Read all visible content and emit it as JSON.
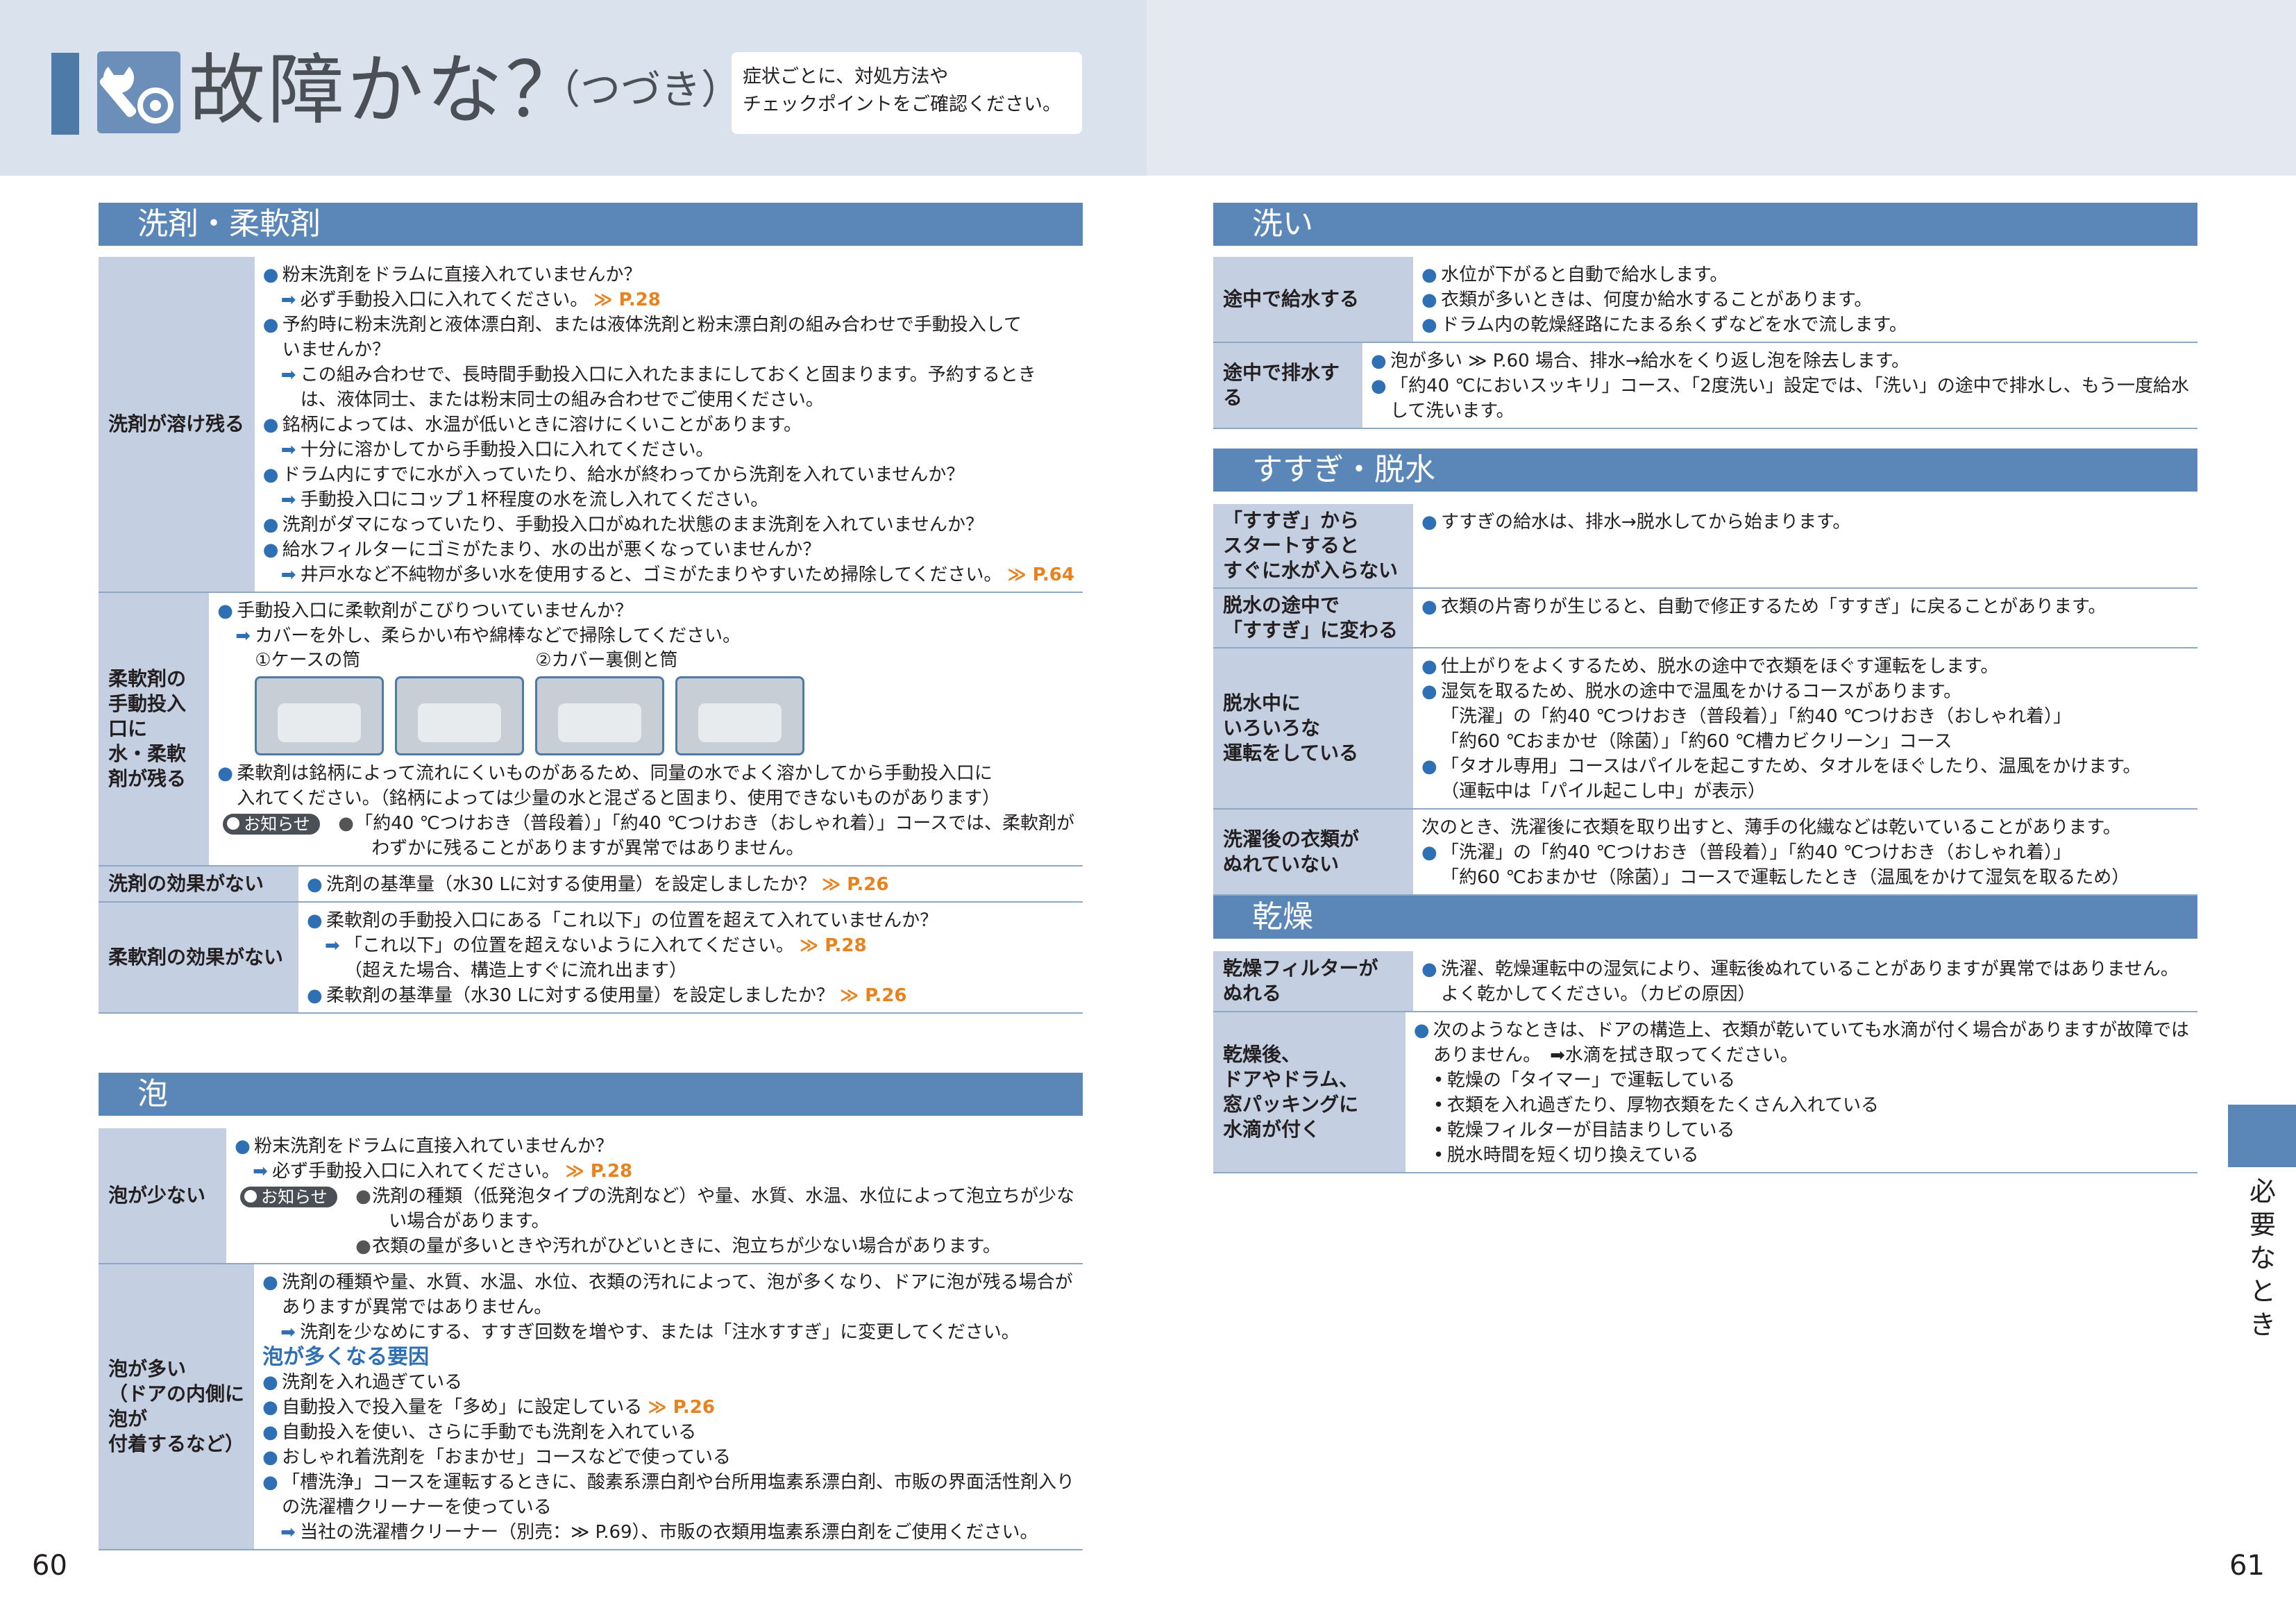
{
  "header": {
    "title": "故障かな？",
    "title_sub": "（つづき）",
    "note_lines": [
      "症状ごとに、対処方法や",
      "チェックポイントをご確認ください。"
    ]
  },
  "left": {
    "detergent": {
      "heading": "洗剤・柔軟剤",
      "rows": [
        {
          "label": [
            "洗剤が溶け残る"
          ],
          "lines": [
            {
              "t": "b",
              "s": "粉末洗剤をドラムに直接入れていませんか？"
            },
            {
              "t": "ar",
              "s": "必ず手動投入口に入れてください。",
              "ref": "≫ P.28"
            },
            {
              "t": "b",
              "s": "予約時に粉末洗剤と液体漂白剤、または液体洗剤と粉末漂白剤の組み合わせで手動投入して"
            },
            {
              "t": "in2",
              "s": "いませんか？"
            },
            {
              "t": "ar",
              "s": "この組み合わせで、長時間手動投入口に入れたままにしておくと固まります。予約するとき"
            },
            {
              "t": "in",
              "s": "は、液体同士、または粉末同士の組み合わせでご使用ください。"
            },
            {
              "t": "b",
              "s": "銘柄によっては、水温が低いときに溶けにくいことがあります。"
            },
            {
              "t": "ar",
              "s": "十分に溶かしてから手動投入口に入れてください。"
            },
            {
              "t": "b",
              "s": "ドラム内にすでに水が入っていたり、給水が終わってから洗剤を入れていませんか？"
            },
            {
              "t": "ar",
              "s": "手動投入口にコップ１杯程度の水を流し入れてください。"
            },
            {
              "t": "b",
              "s": "洗剤がダマになっていたり、手動投入口がぬれた状態のまま洗剤を入れていませんか？"
            },
            {
              "t": "b",
              "s": "給水フィルターにゴミがたまり、水の出が悪くなっていませんか？"
            },
            {
              "t": "ar",
              "s": "井戸水など不純物が多い水を使用すると、ゴミがたまりやすいため掃除してください。",
              "ref": "≫ P.64"
            }
          ]
        },
        {
          "label": [
            "柔軟剤の",
            "手動投入口に",
            "水・柔軟剤が残る"
          ],
          "photos": true,
          "lines": [
            {
              "t": "b",
              "s": "手動投入口に柔軟剤がこびりついていませんか？"
            },
            {
              "t": "ar",
              "s": "カバーを外し、柔らかい布や綿棒などで掃除してください。"
            }
          ],
          "photo_caps": [
            "①ケースの筒",
            "②カバー裏側と筒"
          ],
          "lines2": [
            {
              "t": "b",
              "s": "柔軟剤は銘柄によって流れにくいものがあるため、同量の水でよく溶かしてから手動投入口に"
            },
            {
              "t": "in2",
              "s": "入れてください。（銘柄によっては少量の水と混ざると固まり、使用できないものがあります）"
            },
            {
              "t": "sb",
              "s": "「約40 ℃つけおき（普段着）」「約40 ℃つけおき（おしゃれ着）」コースでは、柔軟剤が",
              "badge": "お知らせ"
            },
            {
              "t": "sbi",
              "s": "わずかに残ることがありますが異常ではありません。"
            }
          ]
        },
        {
          "label": [
            "洗剤の効果がない"
          ],
          "lines": [
            {
              "t": "b",
              "s": "洗剤の基準量（水30 Lに対する使用量）を設定しましたか？",
              "ref": "≫ P.26"
            }
          ]
        },
        {
          "label": [
            "柔軟剤の効果がない"
          ],
          "lines": [
            {
              "t": "b",
              "s": "柔軟剤の手動投入口にある「これ以下」の位置を超えて入れていませんか？"
            },
            {
              "t": "ar",
              "s": "「これ以下」の位置を超えないように入れてください。",
              "ref": "≫ P.28"
            },
            {
              "t": "in",
              "s": "（超えた場合、構造上すぐに流れ出ます）"
            },
            {
              "t": "b",
              "s": "柔軟剤の基準量（水30 Lに対する使用量）を設定しましたか？",
              "ref": "≫ P.26"
            }
          ]
        }
      ]
    },
    "foam": {
      "heading": "泡",
      "rows": [
        {
          "label": [
            "泡が少ない"
          ],
          "lines": [
            {
              "t": "b",
              "s": "粉末洗剤をドラムに直接入れていませんか？"
            },
            {
              "t": "ar",
              "s": "必ず手動投入口に入れてください。",
              "ref": "≫ P.28"
            },
            {
              "t": "sb",
              "s": "洗剤の種類（低発泡タイプの洗剤など）や量、水質、水温、水位によって泡立ちが少な",
              "badge": "お知らせ"
            },
            {
              "t": "sbi",
              "s": "い場合があります。"
            },
            {
              "t": "sb",
              "s": "衣類の量が多いときや汚れがひどいときに、泡立ちが少ない場合があります。"
            }
          ]
        },
        {
          "label": [
            "泡が多い",
            "（ドアの内側に泡が",
            "付着するなど）"
          ],
          "lines": [
            {
              "t": "b",
              "s": "洗剤の種類や量、水質、水温、水位、衣類の汚れによって、泡が多くなり、ドアに泡が残る場合が"
            },
            {
              "t": "in2",
              "s": "ありますが異常ではありません。"
            },
            {
              "t": "ar",
              "s": "洗剤を少なめにする、すすぎ回数を増やす、または「注水すすぎ」に変更してください。"
            },
            {
              "t": "hd",
              "s": "泡が多くなる要因"
            },
            {
              "t": "b",
              "s": "洗剤を入れ過ぎている"
            },
            {
              "t": "b",
              "s": "自動投入で投入量を「多め」に設定している",
              "ref": "≫ P.26"
            },
            {
              "t": "b",
              "s": "自動投入を使い、さらに手動でも洗剤を入れている"
            },
            {
              "t": "b",
              "s": "おしゃれ着洗剤を「おまかせ」コースなどで使っている"
            },
            {
              "t": "b",
              "s": "「槽洗浄」コースを運転するときに、酸素系漂白剤や台所用塩素系漂白剤、市販の界面活性剤入り"
            },
            {
              "t": "in2",
              "s": "の洗濯槽クリーナーを使っている"
            },
            {
              "t": "ar",
              "s": "当社の洗濯槽クリーナー（別売：≫ P.69）、市販の衣類用塩素系漂白剤をご使用ください。"
            }
          ]
        }
      ]
    }
  },
  "right": {
    "wash": {
      "heading": "洗い",
      "rows": [
        {
          "label": [
            "途中で給水する"
          ],
          "lines": [
            {
              "t": "b",
              "s": "水位が下がると自動で給水します。"
            },
            {
              "t": "b",
              "s": "衣類が多いときは、何度か給水することがあります。"
            },
            {
              "t": "b",
              "s": "ドラム内の乾燥経路にたまる糸くずなどを水で流します。"
            }
          ]
        },
        {
          "label": [
            "途中で排水する"
          ],
          "lines": [
            {
              "t": "b",
              "s": "泡が多い ≫ P.60 場合、排水→給水をくり返し泡を除去します。"
            },
            {
              "t": "b",
              "s": "「約40 ℃においスッキリ」コース、「2度洗い」設定では、「洗い」の途中で排水し、もう一度給水"
            },
            {
              "t": "in2",
              "s": "して洗います。"
            }
          ]
        }
      ]
    },
    "rinse": {
      "heading": "すすぎ・脱水",
      "rows": [
        {
          "label": [
            "「すすぎ」から",
            "スタートすると",
            "すぐに水が入らない"
          ],
          "lines": [
            {
              "t": "b",
              "s": "すすぎの給水は、排水→脱水してから始まります。"
            }
          ]
        },
        {
          "label": [
            "脱水の途中で",
            "「すすぎ」に変わる"
          ],
          "lines": [
            {
              "t": "b",
              "s": "衣類の片寄りが生じると、自動で修正するため「すすぎ」に戻ることがあります。"
            }
          ]
        },
        {
          "label": [
            "脱水中に",
            "いろいろな",
            "運転をしている"
          ],
          "lines": [
            {
              "t": "b",
              "s": "仕上がりをよくするため、脱水の途中で衣類をほぐす運転をします。"
            },
            {
              "t": "b",
              "s": "湿気を取るため、脱水の途中で温風をかけるコースがあります。"
            },
            {
              "t": "in2",
              "s": "「洗濯」の「約40 ℃つけおき（普段着）」「約40 ℃つけおき（おしゃれ着）」"
            },
            {
              "t": "in2",
              "s": "「約60 ℃おまかせ（除菌）」「約60 ℃槽カビクリーン」コース"
            },
            {
              "t": "b",
              "s": "「タオル専用」コースはパイルを起こすため、タオルをほぐしたり、温風をかけます。"
            },
            {
              "t": "in2",
              "s": "（運転中は「パイル起こし中」が表示）"
            }
          ]
        },
        {
          "label": [
            "洗濯後の衣類が",
            "ぬれていない"
          ],
          "lines": [
            {
              "t": "plain",
              "s": "次のとき、洗濯後に衣類を取り出すと、薄手の化繊などは乾いていることがあります。"
            },
            {
              "t": "b",
              "s": "「洗濯」の「約40 ℃つけおき（普段着）」「約40 ℃つけおき（おしゃれ着）」"
            },
            {
              "t": "in2",
              "s": "「約60 ℃おまかせ（除菌）」コースで運転したとき（温風をかけて湿気を取るため）"
            }
          ]
        }
      ]
    },
    "dry": {
      "heading": "乾燥",
      "rows": [
        {
          "label": [
            "乾燥フィルターが",
            "ぬれる"
          ],
          "lines": [
            {
              "t": "b",
              "s": "洗濯、乾燥運転中の湿気により、運転後ぬれていることがありますが異常ではありません。"
            },
            {
              "t": "in2",
              "s": "よく乾かしてください。（カビの原因）"
            }
          ]
        },
        {
          "label": [
            "乾燥後、",
            "ドアやドラム、",
            "窓パッキングに",
            "水滴が付く"
          ],
          "lines": [
            {
              "t": "b",
              "s": "次のようなときは、ドアの構造上、衣類が乾いていても水滴が付く場合がありますが故障では"
            },
            {
              "t": "in2",
              "s": "ありません。　➡水滴を拭き取ってください。"
            },
            {
              "t": "dt",
              "s": "乾燥の「タイマー」で運転している"
            },
            {
              "t": "dt",
              "s": "衣類を入れ過ぎたり、厚物衣類をたくさん入れている"
            },
            {
              "t": "dt",
              "s": "乾燥フィルターが目詰まりしている"
            },
            {
              "t": "dt",
              "s": "脱水時間を短く切り換えている"
            }
          ]
        }
      ]
    }
  },
  "side_tab": "必要なとき",
  "page_left": "60",
  "page_right": "61"
}
